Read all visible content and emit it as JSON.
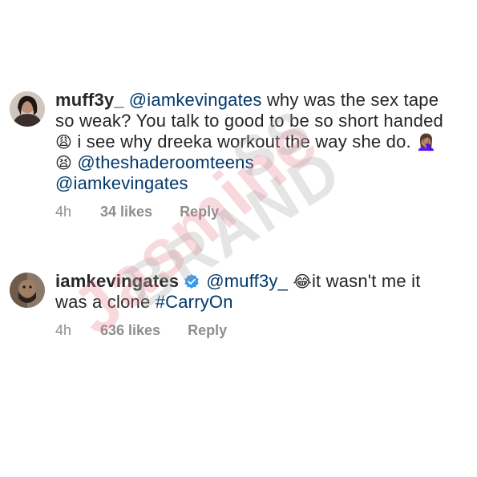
{
  "comments": [
    {
      "username": "muff3y_",
      "mention1": "@iamkevingates",
      "text1": " why was the sex tape so weak? You talk to good to be so short handed ",
      "emoji1": "😩",
      "text2": " i see why dreeka workout the way she do. ",
      "emoji2": "🤦🏽‍♀️",
      "emoji3": "😫",
      "mention2": "@theshaderoomteens",
      "mention3": "@iamkevingates",
      "time": "4h",
      "likes": "34 likes",
      "reply": "Reply"
    },
    {
      "username": "iamkevingates",
      "verified": true,
      "mention1": "@muff3y_",
      "emoji1": "😂",
      "text1": "it wasn't me it was a clone ",
      "hashtag": "#CarryOn",
      "time": "4h",
      "likes": "636 likes",
      "reply": "Reply"
    }
  ],
  "watermark": {
    "line1": "Jasmine",
    "line2": "BRAND",
    "line3": "SS"
  },
  "colors": {
    "text": "#262626",
    "meta": "#8e8e8e",
    "mention": "#00376b",
    "verified": "#3897f0"
  }
}
